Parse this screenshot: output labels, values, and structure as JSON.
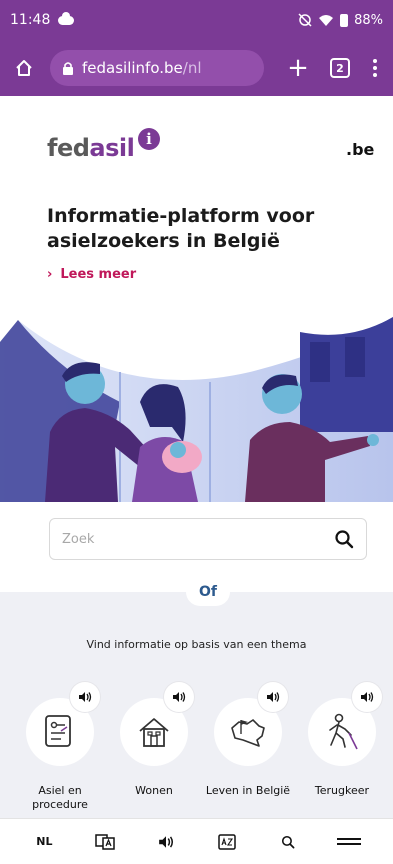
{
  "status": {
    "time": "11:48",
    "battery": "88%"
  },
  "browser": {
    "url_host": "fedasilinfo.be",
    "url_path": "/nl",
    "tab_count": "2"
  },
  "header": {
    "logo_prefix": "fed",
    "logo_suffix": "asil",
    "logo_info": "i",
    "be_logo": ".be"
  },
  "hero": {
    "title": "Informatie-platform voor asielzoekers in België",
    "read_more": "Lees meer"
  },
  "search": {
    "placeholder": "Zoek"
  },
  "themes": {
    "or_label": "Of",
    "heading": "Vind informatie op basis van een thema",
    "items": [
      {
        "label": "Asiel en procedure",
        "icon": "document-procedure-icon"
      },
      {
        "label": "Wonen",
        "icon": "house-icon"
      },
      {
        "label": "Leven in België",
        "icon": "belgium-map-icon"
      },
      {
        "label": "Terugkeer",
        "icon": "walking-person-icon"
      }
    ]
  },
  "toolbar": {
    "language": "NL"
  },
  "colors": {
    "brand_purple": "#7b3a95",
    "accent_red": "#c0185a",
    "panel_bg": "#eff0f5"
  }
}
